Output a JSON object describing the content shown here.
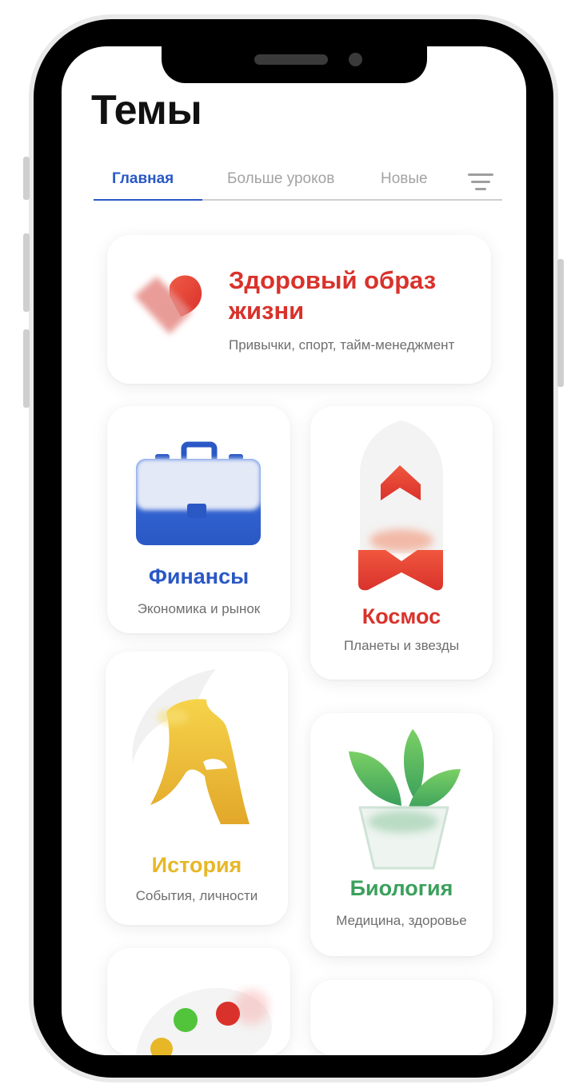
{
  "page": {
    "title": "Темы"
  },
  "tabs": [
    {
      "label": "Главная",
      "active": true
    },
    {
      "label": "Больше уроков",
      "active": false
    },
    {
      "label": "Новые",
      "active": false
    }
  ],
  "filter": {
    "icon": "filter-icon"
  },
  "topics": {
    "health": {
      "title_line1": "Здоровый образ",
      "title_line2": "жизни",
      "subtitle": "Привычки, спорт, тайм-менеджмент",
      "color": "#d9322b",
      "icon": "heart-icon"
    },
    "finance": {
      "title": "Финансы",
      "subtitle": "Экономика и рынок",
      "color": "#2a58c5",
      "icon": "briefcase-icon"
    },
    "space": {
      "title": "Космос",
      "subtitle": "Планеты и звезды",
      "color": "#d9322b",
      "icon": "rocket-icon"
    },
    "history": {
      "title": "История",
      "subtitle": "События, личности",
      "color": "#e7b728",
      "icon": "helmet-icon"
    },
    "biology": {
      "title": "Биология",
      "subtitle": "Медицина, здоровье",
      "color": "#3ba05c",
      "icon": "plant-icon"
    },
    "art": {
      "icon": "palette-icon"
    }
  }
}
